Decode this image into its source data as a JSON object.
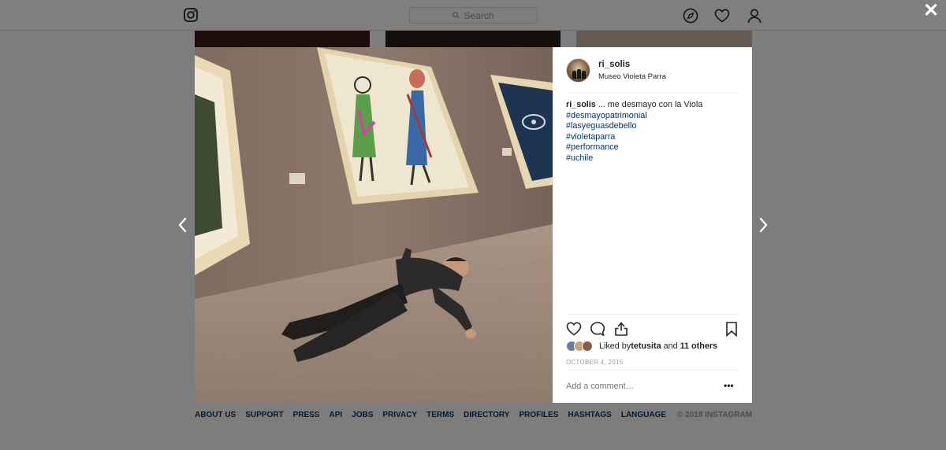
{
  "topbar": {
    "search_placeholder": "Search",
    "icons": [
      "instagram-logo-icon",
      "compass-icon",
      "heart-icon",
      "user-icon"
    ]
  },
  "modal": {
    "close_label": "✕",
    "user": {
      "username": "ri_solis",
      "location": "Museo Violeta Parra"
    },
    "caption": {
      "username": "ri_solis",
      "text": " ... me desmayo con la Viola",
      "hashtags": [
        "#desmayopatrimonial",
        "#lasyeguasdebello",
        "#violetaparra",
        "#performance",
        "#uchile"
      ]
    },
    "likes": {
      "prefix": "Liked by ",
      "user": "tetusita",
      "middle": " and ",
      "others": "11 others"
    },
    "date": "OCTOBER 4, 2015",
    "comment_placeholder": "Add a comment…",
    "more_label": "•••"
  },
  "footer": {
    "links": [
      "ABOUT US",
      "SUPPORT",
      "PRESS",
      "API",
      "JOBS",
      "PRIVACY",
      "TERMS",
      "DIRECTORY",
      "PROFILES",
      "HASHTAGS",
      "LANGUAGE"
    ],
    "copyright": "© 2018 INSTAGRAM"
  },
  "colors": {
    "link": "#003569",
    "text": "#262626",
    "muted": "#999999",
    "overlay": "rgba(0,0,0,0.5)"
  }
}
